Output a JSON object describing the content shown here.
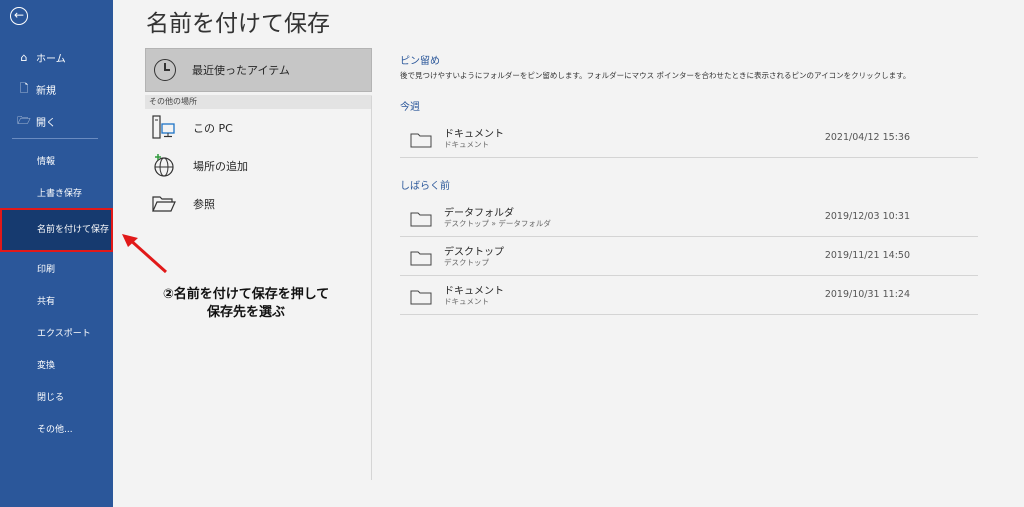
{
  "sidebar": {
    "back_icon": "←",
    "top_items": [
      {
        "label": "ホーム",
        "icon": "⌂"
      },
      {
        "label": "新規",
        "icon": "🗋"
      },
      {
        "label": "開く",
        "icon": "🗁"
      }
    ],
    "bottom_items": [
      {
        "label": "情報"
      },
      {
        "label": "上書き保存"
      },
      {
        "label": "名前を付けて保存"
      },
      {
        "label": "印刷"
      },
      {
        "label": "共有"
      },
      {
        "label": "エクスポート"
      },
      {
        "label": "変換"
      },
      {
        "label": "閉じる"
      },
      {
        "label": "その他..."
      }
    ],
    "active_index": 2
  },
  "page_title": "名前を付けて保存",
  "locations": {
    "recent_label": "最近使ったアイテム",
    "other_header": "その他の場所",
    "items": [
      {
        "label": "この PC",
        "icon": "pc-icon"
      },
      {
        "label": "場所の追加",
        "icon": "globe-add-icon"
      },
      {
        "label": "参照",
        "icon": "open-folder-icon"
      }
    ]
  },
  "pinned": {
    "title": "ピン留め",
    "description": "後で見つけやすいようにフォルダーをピン留めします。フォルダーにマウス ポインターを合わせたときに表示されるピンのアイコンをクリックします。"
  },
  "this_week": {
    "title": "今週",
    "items": [
      {
        "name": "ドキュメント",
        "path": "ドキュメント",
        "date": "2021/04/12 15:36"
      }
    ]
  },
  "earlier": {
    "title": "しばらく前",
    "items": [
      {
        "name": "データフォルダ",
        "path": "デスクトップ » データフォルダ",
        "date": "2019/12/03 10:31"
      },
      {
        "name": "デスクトップ",
        "path": "デスクトップ",
        "date": "2019/11/21 14:50"
      },
      {
        "name": "ドキュメント",
        "path": "ドキュメント",
        "date": "2019/10/31 11:24"
      }
    ]
  },
  "annotation": {
    "line1": "②名前を付けて保存を押して",
    "line2": "保存先を選ぶ",
    "color": "#e11919"
  },
  "colors": {
    "sidebar": "#2b579a",
    "sidebar_active": "#163a6f",
    "highlight": "#e11919"
  }
}
